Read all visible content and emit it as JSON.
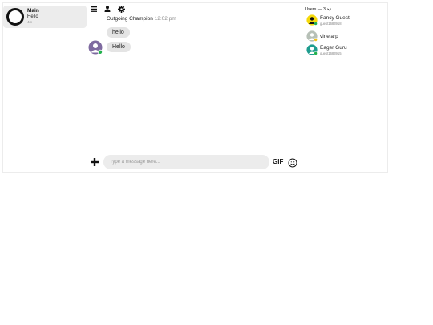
{
  "channels": [
    {
      "name": "Main",
      "preview": "Hello",
      "time": "4m",
      "icon": "circle-logo-icon"
    }
  ],
  "toolbar": {
    "icons": [
      "menu-icon",
      "user-icon",
      "settings-gear-icon"
    ]
  },
  "messages": {
    "sender": "Outgoing Champion",
    "time": "12:02 pm",
    "bubbles": [
      {
        "text": "hello"
      },
      {
        "text": "Hello",
        "icon": "user-avatar-icon"
      }
    ]
  },
  "composer": {
    "placeholder": "Type a message here...",
    "gif_label": "GIF",
    "add_icon": "plus-icon",
    "emoji_icon": "smiley-icon"
  },
  "users_panel": {
    "label": "Users — 3",
    "toggle_icon": "chevron-down-icon",
    "users": [
      {
        "name": "Fancy Guest",
        "sub": "guest1683918",
        "avatar_color": "#f5d90a",
        "status": "online"
      },
      {
        "name": "vinelarp",
        "sub": "",
        "avatar_color": "#b7c0b7",
        "status": "away"
      },
      {
        "name": "Eager Guru",
        "sub": "guest1683915",
        "avatar_color": "#1f9d8f",
        "status": "online"
      }
    ]
  },
  "colors": {
    "online": "#22b14c",
    "away": "#f2c31b",
    "bubble": "#e4e4e4",
    "panel": "#ececec"
  }
}
